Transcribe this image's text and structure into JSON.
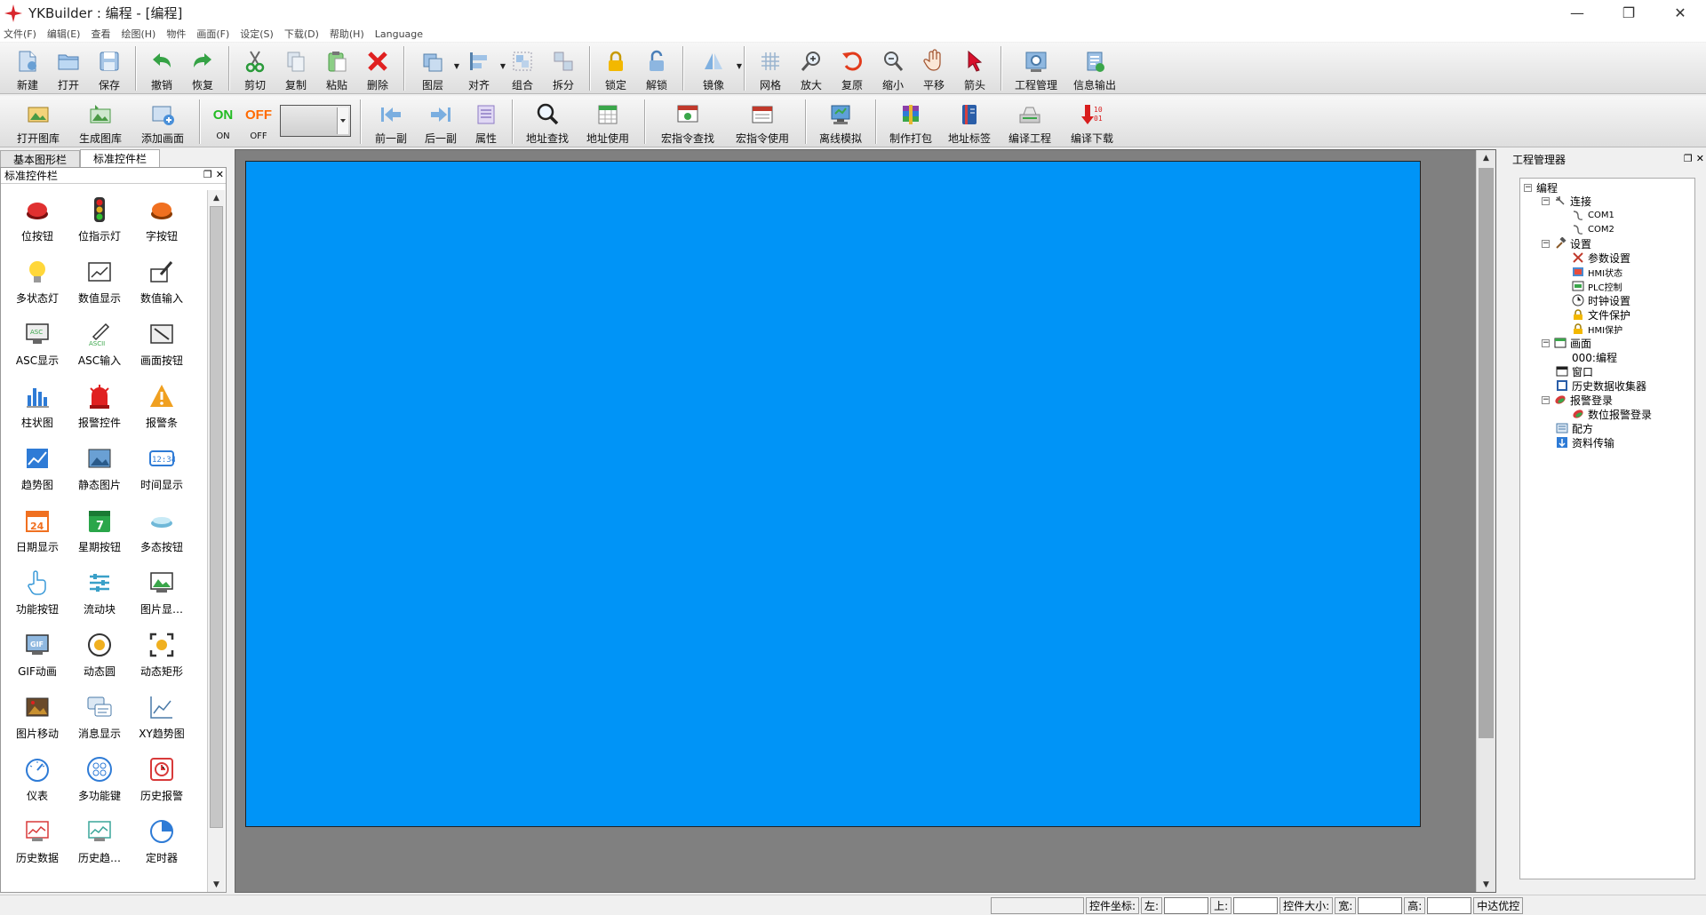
{
  "window": {
    "title": "YKBuilder : 编程 - [编程]",
    "min": "—",
    "max": "❐",
    "close": "✕"
  },
  "menu": [
    "文件(F)",
    "编辑(E)",
    "查看",
    "绘图(H)",
    "物件",
    "画面(F)",
    "设定(S)",
    "下载(D)",
    "帮助(H)",
    "Language"
  ],
  "toolbar1": {
    "new": "新建",
    "open": "打开",
    "save": "保存",
    "undo": "撤销",
    "redo": "恢复",
    "cut": "剪切",
    "copy": "复制",
    "paste": "粘贴",
    "delete": "删除",
    "layer": "图层",
    "align": "对齐",
    "group": "组合",
    "ungroup": "拆分",
    "lock": "锁定",
    "unlock": "解锁",
    "mirror": "镜像",
    "grid": "网格",
    "zoom_in": "放大",
    "restore": "复原",
    "zoom_out": "缩小",
    "pan": "平移",
    "arrow": "箭头",
    "project_mgr": "工程管理",
    "info_output": "信息输出"
  },
  "toolbar2": {
    "open_gallery": "打开图库",
    "make_gallery": "生成图库",
    "add_screen": "添加画面",
    "on_text": "ON",
    "on_label": "ON",
    "off_text": "OFF",
    "off_label": "OFF",
    "prev": "前一副",
    "next": "后一副",
    "props": "属性",
    "addr_find": "地址查找",
    "addr_use": "地址使用",
    "macro_find": "宏指令查找",
    "macro_use": "宏指令使用",
    "offline_sim": "离线模拟",
    "pack": "制作打包",
    "addr_tag": "地址标签",
    "compile": "编译工程",
    "compile_dl": "编译下载"
  },
  "left_tabs": [
    "基本图形栏",
    "标准控件栏"
  ],
  "left_panel": {
    "title": "标准控件栏"
  },
  "controls": [
    {
      "label": "位按钮",
      "icon": "bit-button-icon"
    },
    {
      "label": "位指示灯",
      "icon": "traffic-light-icon"
    },
    {
      "label": "字按钮",
      "icon": "word-button-icon"
    },
    {
      "label": "多状态灯",
      "icon": "bulb-icon"
    },
    {
      "label": "数值显示",
      "icon": "numeric-display-icon"
    },
    {
      "label": "数值输入",
      "icon": "numeric-input-icon"
    },
    {
      "label": "ASC显示",
      "icon": "ascii-display-icon"
    },
    {
      "label": "ASC输入",
      "icon": "ascii-input-icon"
    },
    {
      "label": "画面按钮",
      "icon": "screen-button-icon"
    },
    {
      "label": "柱状图",
      "icon": "bar-chart-icon"
    },
    {
      "label": "报警控件",
      "icon": "alarm-control-icon"
    },
    {
      "label": "报警条",
      "icon": "warning-bar-icon"
    },
    {
      "label": "趋势图",
      "icon": "trend-chart-icon"
    },
    {
      "label": "静态图片",
      "icon": "static-picture-icon"
    },
    {
      "label": "时间显示",
      "icon": "time-display-icon"
    },
    {
      "label": "日期显示",
      "icon": "date-display-icon"
    },
    {
      "label": "星期按钮",
      "icon": "weekday-button-icon"
    },
    {
      "label": "多态按钮",
      "icon": "multistate-button-icon"
    },
    {
      "label": "功能按钮",
      "icon": "hand-pointer-icon"
    },
    {
      "label": "流动块",
      "icon": "flow-block-icon"
    },
    {
      "label": "图片显…",
      "icon": "picture-display-icon"
    },
    {
      "label": "GIF动画",
      "icon": "gif-animation-icon"
    },
    {
      "label": "动态圆",
      "icon": "dynamic-circle-icon"
    },
    {
      "label": "动态矩形",
      "icon": "dynamic-rect-icon"
    },
    {
      "label": "图片移动",
      "icon": "picture-move-icon"
    },
    {
      "label": "消息显示",
      "icon": "message-display-icon"
    },
    {
      "label": "XY趋势图",
      "icon": "xy-trend-icon"
    },
    {
      "label": "仪表",
      "icon": "gauge-icon"
    },
    {
      "label": "多功能键",
      "icon": "multifunction-key-icon"
    },
    {
      "label": "历史报警",
      "icon": "history-alarm-icon"
    },
    {
      "label": "历史数据",
      "icon": "history-data-icon"
    },
    {
      "label": "历史趋…",
      "icon": "history-trend-icon"
    },
    {
      "label": "定时器",
      "icon": "timer-icon"
    }
  ],
  "right_panel": {
    "title": "工程管理器"
  },
  "tree": {
    "root": "编程",
    "connect": "连接",
    "com1": "COM1",
    "com2": "COM2",
    "settings": "设置",
    "param": "参数设置",
    "hmi_state": "HMI状态",
    "plc_ctrl": "PLC控制",
    "clock": "时钟设置",
    "file_protect": "文件保护",
    "hmi_protect": "HMI保护",
    "screens": "画面",
    "screen0": "000:编程",
    "window": "窗口",
    "hist_collector": "历史数据收集器",
    "alarm_log": "报警登录",
    "bit_alarm": "数位报警登录",
    "recipe": "配方",
    "data_transfer": "资料传输"
  },
  "statusbar": {
    "coord_label": "控件坐标:",
    "left_label": "左:",
    "top_label": "上:",
    "size_label": "控件大小:",
    "width_label": "宽:",
    "height_label": "高:",
    "priority": "中达优控"
  },
  "colors": {
    "canvas": "#0094f7",
    "workarea": "#808080",
    "on": "#22bb22",
    "off": "#ff6a00"
  }
}
